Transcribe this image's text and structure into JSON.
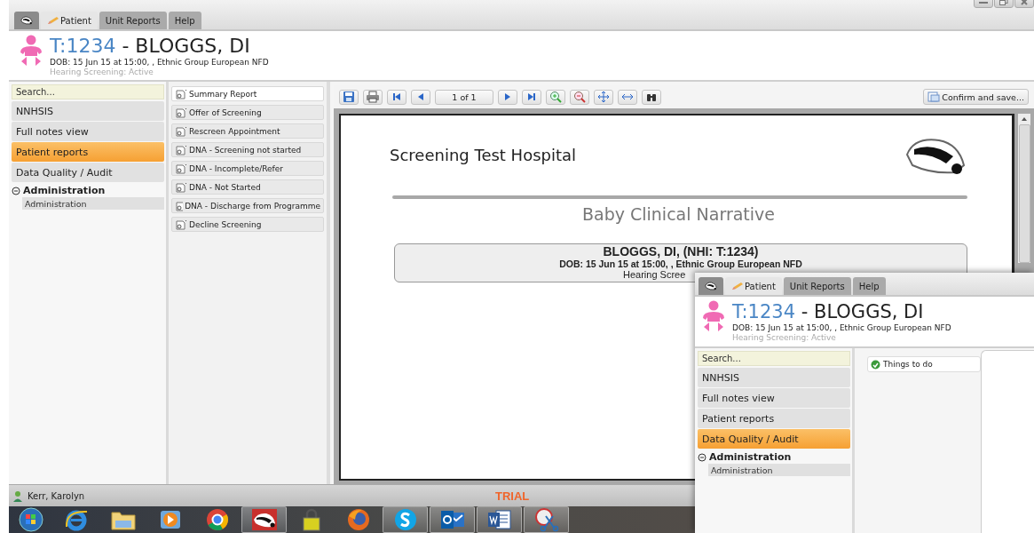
{
  "main_window": {
    "tabs": [
      {
        "kind": "logo",
        "selected": false
      },
      {
        "kind": "text",
        "label": "Patient",
        "selected": true
      },
      {
        "kind": "text",
        "label": "Unit Reports",
        "selected": false
      },
      {
        "kind": "text",
        "label": "Help",
        "selected": false
      }
    ],
    "patient": {
      "id": "T:1234",
      "separator": "-",
      "name": "BLOGGS, DI",
      "details": "DOB: 15 Jun 15 at 15:00, , Ethnic Group European NFD",
      "status": "Hearing Screening: Active"
    },
    "nav": {
      "search_placeholder": "Search...",
      "items": [
        {
          "label": "NNHSIS",
          "selected": false
        },
        {
          "label": "Full notes view",
          "selected": false
        },
        {
          "label": "Patient reports",
          "selected": true
        },
        {
          "label": "Data Quality / Audit",
          "selected": false
        }
      ],
      "group": {
        "label": "Administration",
        "expanded": true,
        "children": [
          {
            "label": "Administration"
          }
        ]
      }
    },
    "content": {
      "kind": "reports",
      "reports": [
        {
          "label": "Summary Report",
          "selected": true
        },
        {
          "label": "Offer of Screening",
          "selected": false
        },
        {
          "label": "Rescreen Appointment",
          "selected": false
        },
        {
          "label": "DNA - Screening not started",
          "selected": false
        },
        {
          "label": "DNA - Incomplete/Refer",
          "selected": false
        },
        {
          "label": "DNA - Not Started",
          "selected": false
        },
        {
          "label": "DNA - Discharge from Programme",
          "selected": false
        },
        {
          "label": "Decline Screening",
          "selected": false
        }
      ],
      "toolbar": {
        "page": "1 of 1",
        "confirm": "Confirm and save..."
      },
      "document": {
        "hospital": "Screening Test Hospital",
        "title": "Baby Clinical Narrative",
        "patient_line": "BLOGGS, DI, (NHI: T:1234)",
        "details_line": "DOB: 15 Jun 15 at 15:00, , Ethnic Group European NFD",
        "status_line": "Hearing Scree"
      }
    },
    "status_bar": {
      "user": "Kerr, Karolyn",
      "badge": "TRIAL"
    }
  },
  "overlay_window": {
    "tabs": [
      {
        "kind": "logo",
        "selected": false
      },
      {
        "kind": "text",
        "label": "Patient",
        "selected": true
      },
      {
        "kind": "text",
        "label": "Unit Reports",
        "selected": false
      },
      {
        "kind": "text",
        "label": "Help",
        "selected": false
      }
    ],
    "patient": {
      "id": "T:1234",
      "separator": "-",
      "name": "BLOGGS, DI",
      "details": "DOB: 15 Jun 15 at 15:00, , Ethnic Group European NFD",
      "status": "Hearing Screening: Active"
    },
    "nav": {
      "search_placeholder": "Search...",
      "items": [
        {
          "label": "NNHSIS",
          "selected": false
        },
        {
          "label": "Full notes view",
          "selected": false
        },
        {
          "label": "Patient reports",
          "selected": false
        },
        {
          "label": "Data Quality / Audit",
          "selected": true
        }
      ],
      "group": {
        "label": "Administration",
        "expanded": true,
        "children": [
          {
            "label": "Administration"
          }
        ]
      }
    },
    "content": {
      "kind": "tasks",
      "tab": "Things to do"
    }
  },
  "taskbar": {
    "items": [
      {
        "kind": "start",
        "running": false
      },
      {
        "kind": "browser",
        "running": false
      },
      {
        "kind": "folder",
        "running": false
      },
      {
        "kind": "media",
        "running": false
      },
      {
        "kind": "chrome",
        "running": false
      },
      {
        "kind": "badger",
        "running": true
      },
      {
        "kind": "lock",
        "running": false
      },
      {
        "kind": "fox",
        "running": false
      },
      {
        "kind": "skype",
        "running": true
      },
      {
        "kind": "mail",
        "running": true
      },
      {
        "kind": "word",
        "running": true
      },
      {
        "kind": "scissors",
        "running": true
      }
    ]
  }
}
